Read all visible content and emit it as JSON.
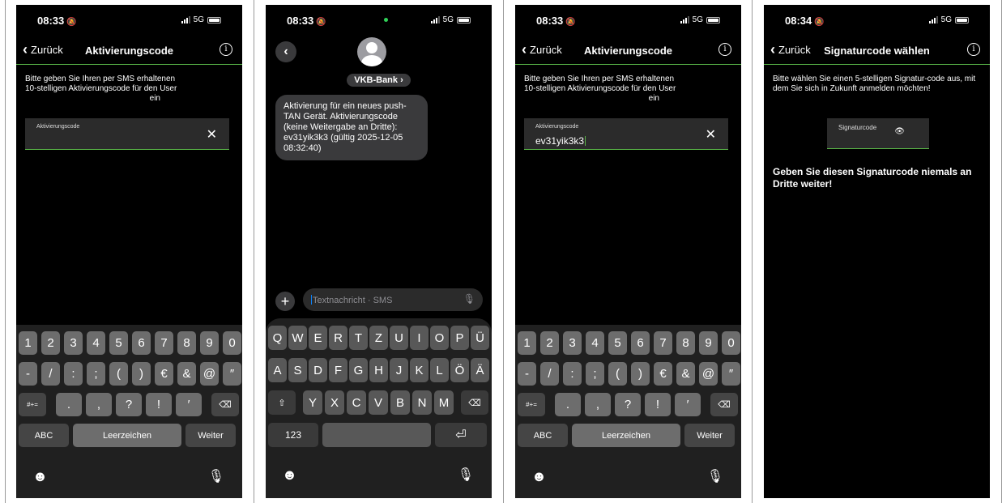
{
  "screen1": {
    "time": "08:33",
    "network": "5G",
    "back_label": "Zurück",
    "title": "Aktivierungscode",
    "instruction_line1": "Bitte geben Sie Ihren per SMS erhaltenen",
    "instruction_line2": "10-stelligen Aktivierungscode für den User",
    "instruction_line3": "ein",
    "field_label": "Aktivierungscode",
    "field_value": ""
  },
  "screen2": {
    "time": "08:33",
    "network": "5G",
    "contact_name": "VKB-Bank",
    "message": "Aktivierung für ein neues push-TAN Gerät. Aktivierungscode (keine Weitergabe an Dritte): ev31yik3k3 (gültig 2025-12-05 08:32:40)",
    "input_placeholder": "Textnachricht · SMS"
  },
  "screen3": {
    "time": "08:33",
    "network": "5G",
    "back_label": "Zurück",
    "title": "Aktivierungscode",
    "instruction_line1": "Bitte geben Sie Ihren per SMS erhaltenen",
    "instruction_line2": "10-stelligen Aktivierungscode für den User",
    "instruction_line3": "ein",
    "field_label": "Aktivierungscode",
    "field_value": "ev31yik3k3"
  },
  "screen4": {
    "time": "08:34",
    "network": "5G",
    "back_label": "Zurück",
    "title": "Signaturcode wählen",
    "instruction": "Bitte wählen Sie einen 5-stelligen Signatur-code aus, mit dem Sie sich in Zukunft anmelden möchten!",
    "field_label": "Signaturcode",
    "warning": "Geben Sie diesen Signaturcode niemals an Dritte weiter!"
  },
  "numeric_keyboard": {
    "row1": [
      "1",
      "2",
      "3",
      "4",
      "5",
      "6",
      "7",
      "8",
      "9",
      "0"
    ],
    "row2": [
      "-",
      "/",
      ":",
      ";",
      "(",
      ")",
      "€",
      "&",
      "@",
      "″"
    ],
    "symbols_toggle": "#+=",
    "row3": [
      ".",
      ",",
      "?",
      "!",
      "′"
    ],
    "abc_label": "ABC",
    "space_label": "Leerzeichen",
    "return_label": "Weiter"
  },
  "alpha_keyboard": {
    "row1": [
      "Q",
      "W",
      "E",
      "R",
      "T",
      "Z",
      "U",
      "I",
      "O",
      "P",
      "Ü"
    ],
    "row2": [
      "A",
      "S",
      "D",
      "F",
      "G",
      "H",
      "J",
      "K",
      "L",
      "Ö",
      "Ä"
    ],
    "row3": [
      "Y",
      "X",
      "C",
      "V",
      "B",
      "N",
      "M"
    ],
    "numbers_label": "123"
  },
  "icons": {
    "back": "chevron-left-icon",
    "info": "info-icon",
    "clear": "close-icon",
    "backspace": "backspace-icon",
    "shift": "shift-icon",
    "emoji": "emoji-icon",
    "mic": "microphone-icon",
    "eye": "eye-icon",
    "return": "return-icon"
  },
  "colors": {
    "accent_green": "#58b447",
    "background": "#000000",
    "field_bg": "#2b2b2b",
    "key_bg": "#6d6d6d",
    "bubble_bg": "#3a3a3c"
  }
}
